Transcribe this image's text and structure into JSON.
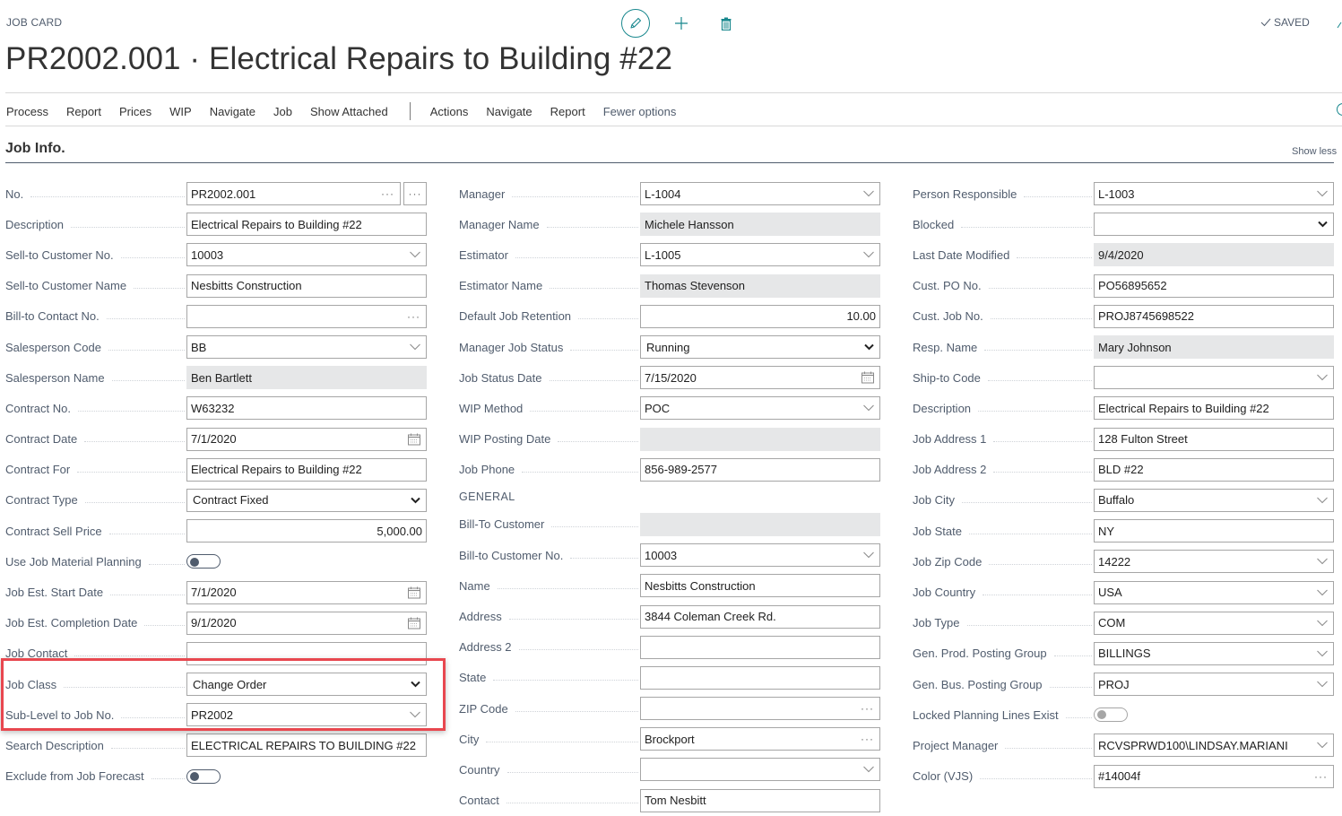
{
  "header": {
    "caption": "JOB CARD",
    "title": "PR2002.001 · Electrical Repairs to Building #22",
    "saved_status": "SAVED",
    "icons": {
      "edit": "pencil-icon",
      "new": "plus-icon",
      "delete": "trash-icon",
      "saved": "checkmark-icon"
    }
  },
  "actions": {
    "promoted": [
      "Process",
      "Report",
      "Prices",
      "WIP",
      "Navigate",
      "Job",
      "Show Attached"
    ],
    "secondary": [
      "Actions",
      "Navigate",
      "Report"
    ],
    "fewer_options": "Fewer options"
  },
  "section": {
    "title": "Job Info.",
    "show_less": "Show less"
  },
  "highlight_color": "#e8474f",
  "accent_color": "#19888e",
  "columns": {
    "col1": [
      {
        "label": "No.",
        "value": "PR2002.001",
        "type": "text",
        "icon": "ellipsis",
        "assist": true
      },
      {
        "label": "Description",
        "value": "Electrical Repairs to Building #22",
        "type": "text"
      },
      {
        "label": "Sell-to Customer No.",
        "value": "10003",
        "type": "text",
        "icon": "chevron"
      },
      {
        "label": "Sell-to Customer Name",
        "value": "Nesbitts Construction",
        "type": "text"
      },
      {
        "label": "Bill-to Contact No.",
        "value": "",
        "type": "text",
        "icon": "ellipsis"
      },
      {
        "label": "Salesperson Code",
        "value": "BB",
        "type": "text",
        "icon": "chevron"
      },
      {
        "label": "Salesperson Name",
        "value": "Ben Bartlett",
        "type": "readonly"
      },
      {
        "label": "Contract No.",
        "value": "W63232",
        "type": "text"
      },
      {
        "label": "Contract Date",
        "value": "7/1/2020",
        "type": "text",
        "icon": "calendar"
      },
      {
        "label": "Contract For",
        "value": "Electrical Repairs to Building #22",
        "type": "text"
      },
      {
        "label": "Contract Type",
        "value": "Contract Fixed",
        "type": "select"
      },
      {
        "label": "Contract Sell Price",
        "value": "5,000.00",
        "type": "num"
      },
      {
        "label": "Use Job Material Planning",
        "value": "off",
        "type": "toggle"
      },
      {
        "label": "Job Est. Start Date",
        "value": "7/1/2020",
        "type": "text",
        "icon": "calendar"
      },
      {
        "label": "Job Est. Completion Date",
        "value": "9/1/2020",
        "type": "text",
        "icon": "calendar"
      },
      {
        "label": "Job Contact",
        "value": "",
        "type": "text"
      },
      {
        "label": "Job Class",
        "value": "Change Order",
        "type": "select"
      },
      {
        "label": "Sub-Level to Job No.",
        "value": "PR2002",
        "type": "text",
        "icon": "chevron"
      },
      {
        "label": "Search Description",
        "value": "ELECTRICAL REPAIRS TO BUILDING #22",
        "type": "text"
      },
      {
        "label": "Exclude from Job Forecast",
        "value": "off",
        "type": "toggle"
      }
    ],
    "col2": [
      {
        "label": "Manager",
        "value": "L-1004",
        "type": "text",
        "icon": "chevron"
      },
      {
        "label": "Manager Name",
        "value": "Michele Hansson",
        "type": "readonly"
      },
      {
        "label": "Estimator",
        "value": "L-1005",
        "type": "text",
        "icon": "chevron"
      },
      {
        "label": "Estimator Name",
        "value": "Thomas Stevenson",
        "type": "readonly"
      },
      {
        "label": "Default Job Retention",
        "value": "10.00",
        "type": "num"
      },
      {
        "label": "Manager Job Status",
        "value": "Running",
        "type": "select"
      },
      {
        "label": "Job Status Date",
        "value": "7/15/2020",
        "type": "text",
        "icon": "calendar"
      },
      {
        "label": "WIP Method",
        "value": "POC",
        "type": "text",
        "icon": "chevron"
      },
      {
        "label": "WIP Posting Date",
        "value": "",
        "type": "readonly"
      },
      {
        "label": "Job Phone",
        "value": "856-989-2577",
        "type": "text"
      },
      {
        "label": "GENERAL",
        "type": "group"
      },
      {
        "label": "Bill-To Customer",
        "value": "",
        "type": "readonly"
      },
      {
        "label": "Bill-to Customer No.",
        "value": "10003",
        "type": "text",
        "icon": "chevron"
      },
      {
        "label": "Name",
        "value": "Nesbitts Construction",
        "type": "text"
      },
      {
        "label": "Address",
        "value": "3844 Coleman Creek Rd.",
        "type": "text"
      },
      {
        "label": "Address 2",
        "value": "",
        "type": "text"
      },
      {
        "label": "State",
        "value": "",
        "type": "text"
      },
      {
        "label": "ZIP Code",
        "value": "",
        "type": "text",
        "icon": "ellipsis"
      },
      {
        "label": "City",
        "value": "Brockport",
        "type": "text",
        "icon": "ellipsis"
      },
      {
        "label": "Country",
        "value": "",
        "type": "text",
        "icon": "chevron"
      },
      {
        "label": "Contact",
        "value": "Tom Nesbitt",
        "type": "text"
      }
    ],
    "col3": [
      {
        "label": "Person Responsible",
        "value": "L-1003",
        "type": "text",
        "icon": "chevron"
      },
      {
        "label": "Blocked",
        "value": "",
        "type": "select"
      },
      {
        "label": "Last Date Modified",
        "value": "9/4/2020",
        "type": "readonly"
      },
      {
        "label": "Cust. PO No.",
        "value": "PO56895652",
        "type": "text"
      },
      {
        "label": "Cust. Job No.",
        "value": "PROJ8745698522",
        "type": "text"
      },
      {
        "label": "Resp. Name",
        "value": "Mary Johnson",
        "type": "readonly"
      },
      {
        "label": "Ship-to Code",
        "value": "",
        "type": "text",
        "icon": "chevron"
      },
      {
        "label": "Description",
        "value": "Electrical Repairs to Building #22",
        "type": "text"
      },
      {
        "label": "Job Address 1",
        "value": "128 Fulton Street",
        "type": "text"
      },
      {
        "label": "Job Address 2",
        "value": "BLD #22",
        "type": "text"
      },
      {
        "label": "Job City",
        "value": "Buffalo",
        "type": "text",
        "icon": "chevron"
      },
      {
        "label": "Job State",
        "value": "NY",
        "type": "text"
      },
      {
        "label": "Job Zip Code",
        "value": "14222",
        "type": "text",
        "icon": "chevron"
      },
      {
        "label": "Job Country",
        "value": "USA",
        "type": "text",
        "icon": "chevron"
      },
      {
        "label": "Job Type",
        "value": "COM",
        "type": "text",
        "icon": "chevron"
      },
      {
        "label": "Gen. Prod. Posting Group",
        "value": "BILLINGS",
        "type": "text",
        "icon": "chevron"
      },
      {
        "label": "Gen. Bus. Posting Group",
        "value": "PROJ",
        "type": "text",
        "icon": "chevron"
      },
      {
        "label": "Locked Planning Lines Exist",
        "value": "off",
        "type": "toggle",
        "disabled": true
      },
      {
        "label": "Project Manager",
        "value": "RCVSPRWD100\\LINDSAY.MARIANI",
        "type": "text",
        "icon": "chevron"
      },
      {
        "label": "Color (VJS)",
        "value": "#14004f",
        "type": "text",
        "icon": "ellipsis"
      }
    ]
  }
}
